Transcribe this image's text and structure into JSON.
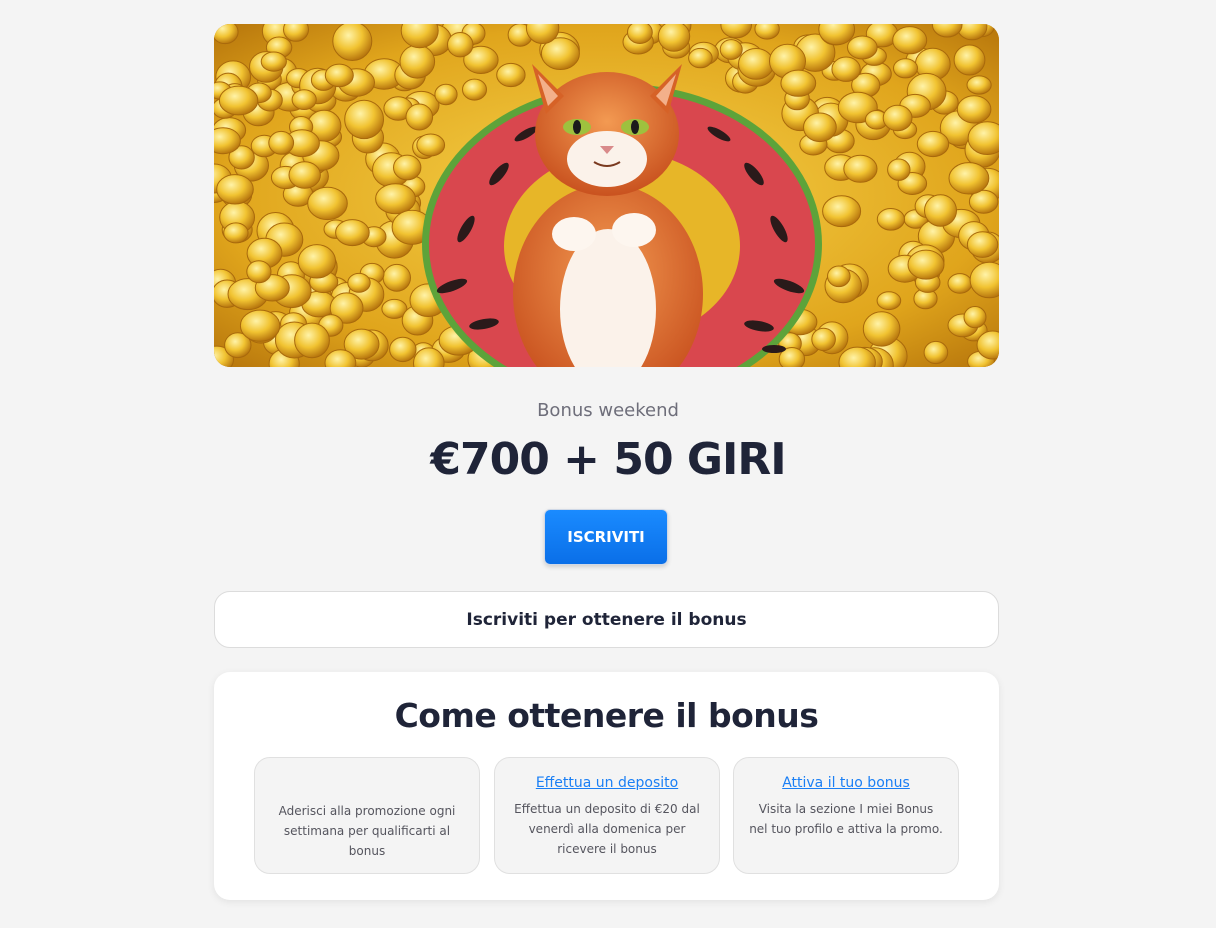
{
  "promo": {
    "subtitle": "Bonus weekend",
    "headline": "€700 + 50 GIRI",
    "cta_label": "ISCRIVITI",
    "signup_bar_label": "Iscriviti per ottenere il bonus"
  },
  "howto": {
    "title": "Come ottenere il bonus",
    "steps": [
      {
        "link": "",
        "text": "Aderisci alla promozione ogni settimana per qualificarti al bonus"
      },
      {
        "link": "Effettua un deposito",
        "text": "Effettua un deposito di €20 dal venerdì alla domenica per ricevere il bonus"
      },
      {
        "link": "Attiva il tuo bonus",
        "text": "Visita la sezione I miei Bonus nel tuo profilo e attiva la promo."
      }
    ]
  },
  "colors": {
    "background": "#f4f4f4",
    "accent_blue": "#0a6fe8",
    "link_blue": "#1a7ff5",
    "text_dark": "#1f2438",
    "banner_gold": "#e8b420",
    "cat_orange": "#d8692a",
    "ring_red": "#d9474e"
  },
  "banner": {
    "icon": "cat-on-watermelon-float-illustration"
  }
}
